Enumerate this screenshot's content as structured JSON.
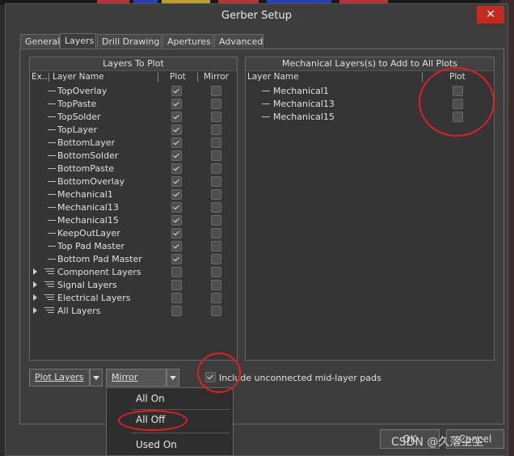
{
  "window": {
    "title": "Gerber Setup"
  },
  "tabs": [
    {
      "label": "General"
    },
    {
      "label": "Layers"
    },
    {
      "label": "Drill Drawing"
    },
    {
      "label": "Apertures"
    },
    {
      "label": "Advanced"
    }
  ],
  "layers_panel": {
    "header": "Layers To Plot",
    "col_expand": "Ex...",
    "col_name": "Layer Name",
    "col_plot": "Plot",
    "col_mirror": "Mirror",
    "rows": [
      {
        "name": "TopOverlay",
        "plot": true,
        "mirror": false,
        "kind": "layer"
      },
      {
        "name": "TopPaste",
        "plot": true,
        "mirror": false,
        "kind": "layer"
      },
      {
        "name": "TopSolder",
        "plot": true,
        "mirror": false,
        "kind": "layer"
      },
      {
        "name": "TopLayer",
        "plot": true,
        "mirror": false,
        "kind": "layer"
      },
      {
        "name": "BottomLayer",
        "plot": true,
        "mirror": false,
        "kind": "layer"
      },
      {
        "name": "BottomSolder",
        "plot": true,
        "mirror": false,
        "kind": "layer"
      },
      {
        "name": "BottomPaste",
        "plot": true,
        "mirror": false,
        "kind": "layer"
      },
      {
        "name": "BottomOverlay",
        "plot": true,
        "mirror": false,
        "kind": "layer"
      },
      {
        "name": "Mechanical1",
        "plot": true,
        "mirror": false,
        "kind": "layer"
      },
      {
        "name": "Mechanical13",
        "plot": true,
        "mirror": false,
        "kind": "layer"
      },
      {
        "name": "Mechanical15",
        "plot": true,
        "mirror": false,
        "kind": "layer"
      },
      {
        "name": "KeepOutLayer",
        "plot": true,
        "mirror": false,
        "kind": "layer"
      },
      {
        "name": "Top Pad Master",
        "plot": true,
        "mirror": false,
        "kind": "layer"
      },
      {
        "name": "Bottom Pad Master",
        "plot": true,
        "mirror": false,
        "kind": "layer"
      },
      {
        "name": "Component Layers",
        "plot": false,
        "mirror": false,
        "kind": "group"
      },
      {
        "name": "Signal Layers",
        "plot": false,
        "mirror": false,
        "kind": "group"
      },
      {
        "name": "Electrical Layers",
        "plot": false,
        "mirror": false,
        "kind": "group"
      },
      {
        "name": "All Layers",
        "plot": false,
        "mirror": false,
        "kind": "group"
      }
    ]
  },
  "mech_panel": {
    "header": "Mechanical Layers(s) to Add to All Plots",
    "col_name": "Layer Name",
    "col_plot": "Plot",
    "rows": [
      {
        "name": "Mechanical1",
        "plot": false
      },
      {
        "name": "Mechanical13",
        "plot": false
      },
      {
        "name": "Mechanical15",
        "plot": false
      }
    ]
  },
  "controls": {
    "plot_layers_label": "Plot Layers",
    "mirror_layers_label": "Mirror Layers",
    "include_pads_label": "Include unconnected mid-layer pads",
    "include_pads_checked": true
  },
  "mirror_menu": {
    "items": [
      {
        "label": "All On"
      },
      {
        "label": "All Off"
      },
      {
        "label": "Used On"
      }
    ]
  },
  "footer": {
    "ok_label": "OK",
    "cancel_label": "Cancel"
  },
  "watermark": "CSDN @久落尘尘",
  "colors": {
    "annotation": "#e02020",
    "close": "#c42b1c",
    "background": "#3d3d3d"
  }
}
